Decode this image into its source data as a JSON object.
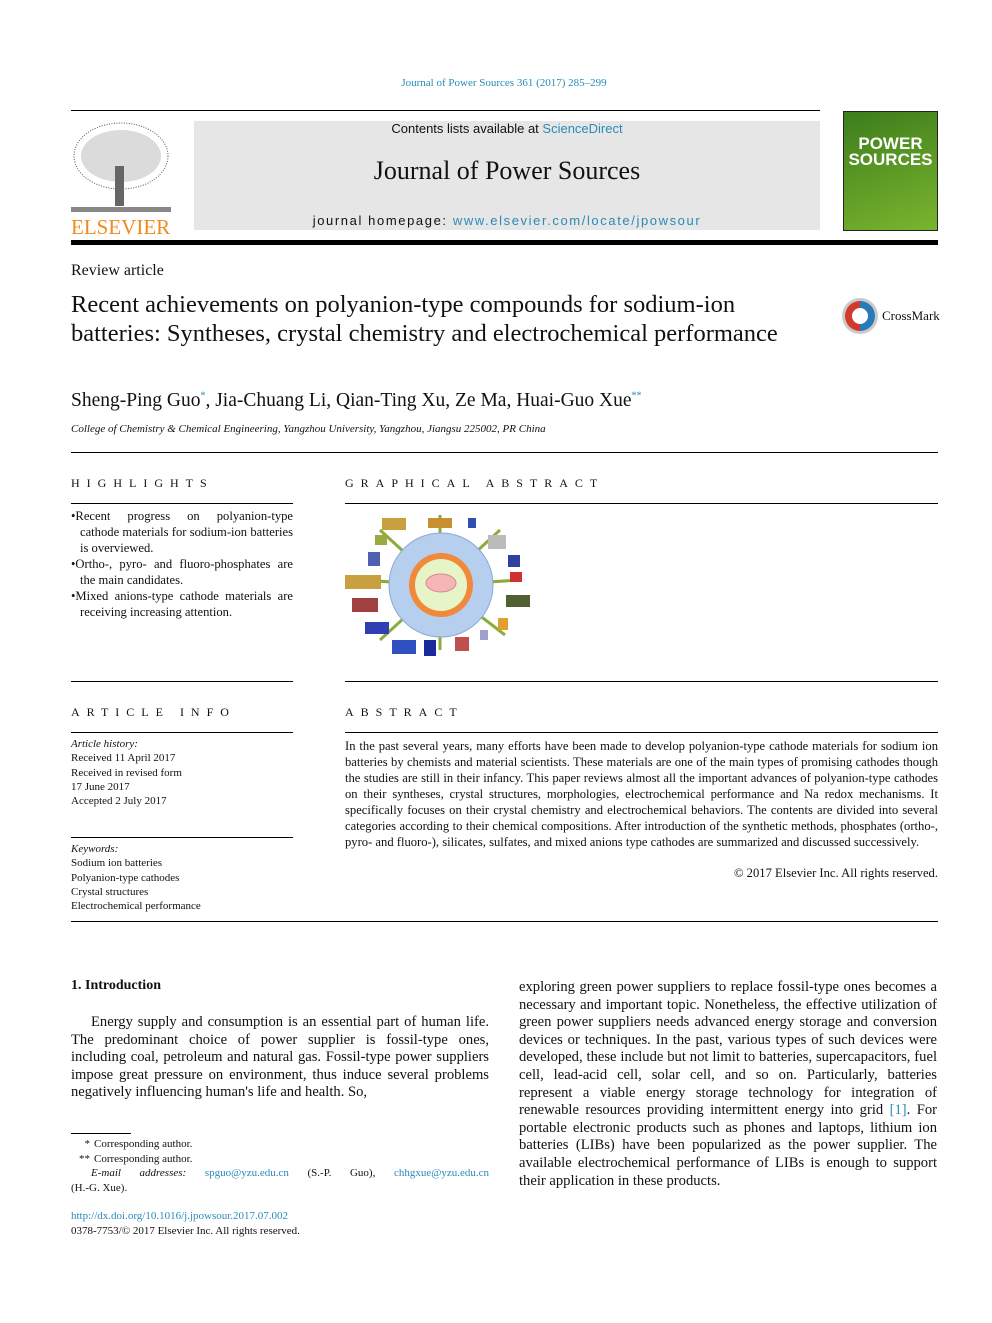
{
  "citation": "Journal of Power Sources 361 (2017) 285–299",
  "header": {
    "contents_prefix": "Contents lists available at ",
    "contents_link": "ScienceDirect",
    "journal_title": "Journal of Power Sources",
    "homepage_prefix": "journal homepage: ",
    "homepage_link": "www.elsevier.com/locate/jpowsour",
    "publisher_logo": "ELSEVIER",
    "cover_title": "POWER SOURCES",
    "colors": {
      "link": "#2a8ab8",
      "elsevier": "#f08a1c",
      "cover": "#5a9e2a",
      "banner": "#e6e6e6"
    }
  },
  "article": {
    "type": "Review article",
    "title": "Recent achievements on polyanion-type compounds for sodium-ion batteries: Syntheses, crystal chemistry and electrochemical performance",
    "crossmark": "CrossMark",
    "authors": [
      {
        "name": "Sheng-Ping Guo",
        "mark": "*"
      },
      {
        "name": "Jia-Chuang Li",
        "mark": ""
      },
      {
        "name": "Qian-Ting Xu",
        "mark": ""
      },
      {
        "name": "Ze Ma",
        "mark": ""
      },
      {
        "name": "Huai-Guo Xue",
        "mark": "**"
      }
    ],
    "affiliation": "College of Chemistry & Chemical Engineering, Yangzhou University, Yangzhou, Jiangsu 225002, PR China"
  },
  "highlights": {
    "heading": "HIGHLIGHTS",
    "items": [
      "Recent progress on polyanion-type cathode materials for sodium-ion batteries is overviewed.",
      "Ortho-, pyro- and fluoro-phosphates are the main candidates.",
      "Mixed anions-type cathode materials are receiving increasing attention."
    ]
  },
  "graphical_abstract": {
    "heading": "GRAPHICAL ABSTRACT"
  },
  "article_info": {
    "heading": "ARTICLE INFO",
    "history_label": "Article history:",
    "history": [
      "Received 11 April 2017",
      "Received in revised form",
      "17 June 2017",
      "Accepted 2 July 2017"
    ],
    "keywords_label": "Keywords:",
    "keywords": [
      "Sodium ion batteries",
      "Polyanion-type cathodes",
      "Crystal structures",
      "Electrochemical performance"
    ]
  },
  "abstract": {
    "heading": "ABSTRACT",
    "text": "In the past several years, many efforts have been made to develop polyanion-type cathode materials for sodium ion batteries by chemists and material scientists. These materials are one of the main types of promising cathodes though the studies are still in their infancy. This paper reviews almost all the important advances of polyanion-type cathodes on their syntheses, crystal structures, morphologies, electrochemical performance and Na redox mechanisms. It specifically focuses on their crystal chemistry and electrochemical behaviors. The contents are divided into several categories according to their chemical compositions. After introduction of the synthetic methods, phosphates (ortho-, pyro- and fluoro-), silicates, sulfates, and mixed anions type cathodes are summarized and discussed successively.",
    "copyright": "© 2017 Elsevier Inc. All rights reserved."
  },
  "intro": {
    "heading": "1.  Introduction",
    "para1": "Energy supply and consumption is an essential part of human life. The predominant choice of power supplier is fossil-type ones, including coal, petroleum and natural gas. Fossil-type power suppliers impose great pressure on environment, thus induce several problems negatively influencing human's life and health. So,",
    "para2_a": "exploring green power suppliers to replace fossil-type ones becomes a necessary and important topic. Nonetheless, the effective utilization of green power suppliers needs advanced energy storage and conversion devices or techniques. In the past, various types of such devices were developed, these include but not limit to batteries, supercapacitors, fuel cell, lead-acid cell, solar cell, and so on. Particularly, batteries represent a viable energy storage technology for integration of renewable resources providing intermittent energy into grid ",
    "para2_ref": "[1]",
    "para2_b": ". For portable electronic products such as phones and laptops, lithium ion batteries (LIBs) have been popularized as the power supplier. The available electrochemical performance of LIBs is enough to support their application in these products."
  },
  "footnotes": {
    "fn1_mark": "*",
    "fn1": "Corresponding author.",
    "fn2_mark": "**",
    "fn2": "Corresponding author.",
    "email_label": "E-mail addresses:",
    "email1": "spguo@yzu.edu.cn",
    "email1_who": " (S.-P. Guo), ",
    "email2": "chhgxue@yzu.edu.cn",
    "email2_who": "(H.-G. Xue).",
    "doi": "http://dx.doi.org/10.1016/j.jpowsour.2017.07.002",
    "issn": "0378-7753/© 2017 Elsevier Inc. All rights reserved."
  }
}
